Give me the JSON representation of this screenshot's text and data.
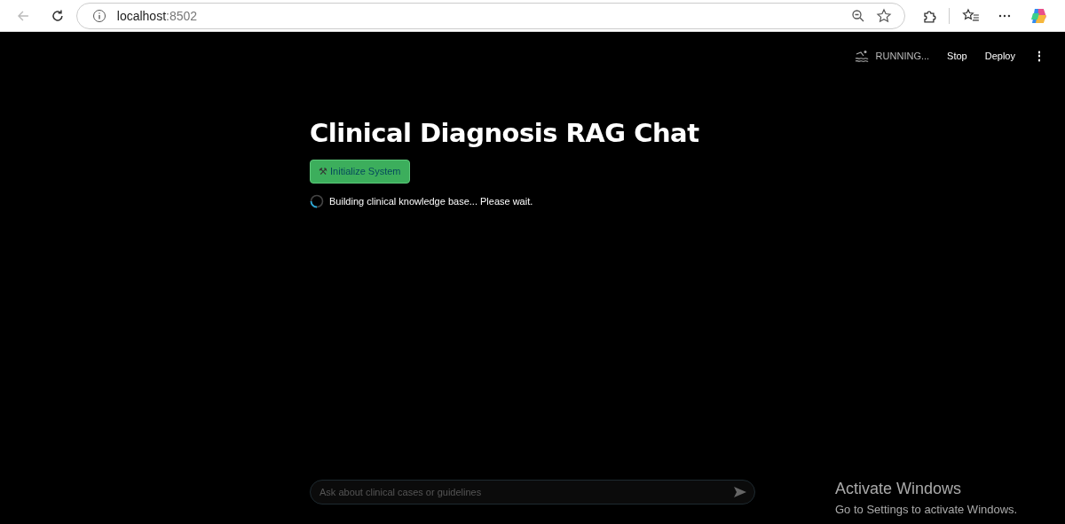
{
  "browser": {
    "url_host": "localhost",
    "url_port": ":8502"
  },
  "header": {
    "status": "RUNNING...",
    "actions": [
      "Stop",
      "Deploy"
    ],
    "menu": "⋮"
  },
  "main": {
    "title": "Clinical Diagnosis RAG Chat",
    "button": {
      "icon": "⚒",
      "label": "Initialize System"
    },
    "spinner_text": "Building clinical knowledge base... Please wait."
  },
  "chat_input": {
    "placeholder": "Ask about clinical cases or guidelines"
  },
  "os_notice": {
    "title": "Activate Windows",
    "text": "Go to Settings to activate Windows."
  }
}
